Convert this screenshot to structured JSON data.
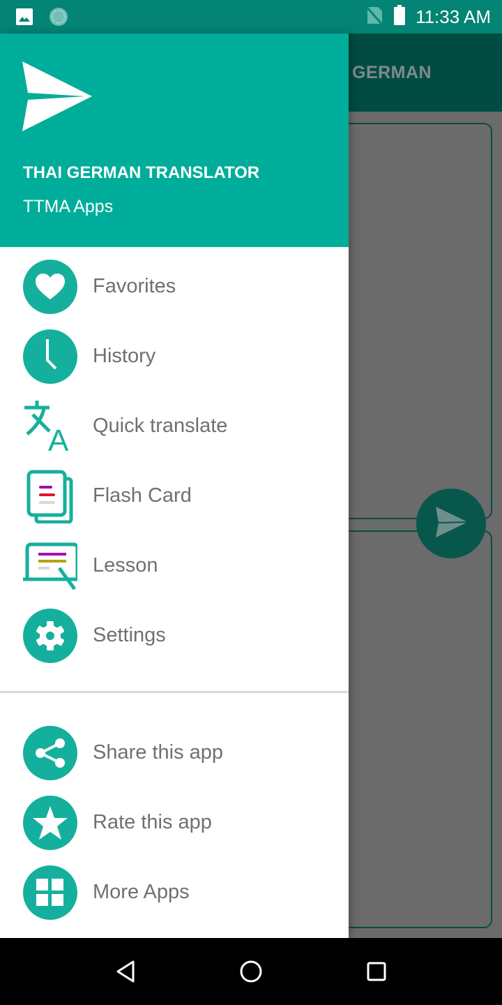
{
  "status_bar": {
    "time": "11:33 AM",
    "left_icons": [
      "gallery-icon",
      "sync-icon"
    ],
    "right_icons": [
      "no-sim-icon",
      "battery-icon"
    ]
  },
  "background_app": {
    "toolbar_title": "GERMAN",
    "fab_icon": "send-icon"
  },
  "drawer": {
    "header": {
      "logo_icon": "paper-plane-icon",
      "title": "THAI GERMAN TRANSLATOR",
      "subtitle": "TTMA Apps"
    },
    "primary_items": [
      {
        "label": "Favorites",
        "icon": "heart-icon"
      },
      {
        "label": "History",
        "icon": "clock-icon"
      },
      {
        "label": "Quick translate",
        "icon": "translate-icon"
      },
      {
        "label": "Flash Card",
        "icon": "flash-card-icon"
      },
      {
        "label": "Lesson",
        "icon": "lesson-board-icon"
      },
      {
        "label": "Settings",
        "icon": "gear-icon"
      }
    ],
    "secondary_items": [
      {
        "label": "Share this app",
        "icon": "share-icon"
      },
      {
        "label": "Rate this app",
        "icon": "star-icon"
      },
      {
        "label": "More Apps",
        "icon": "grid-icon"
      }
    ]
  },
  "nav_bar": {
    "buttons": [
      "back",
      "home",
      "recents"
    ]
  },
  "colors": {
    "accent": "#00ad9a",
    "status_bar": "#038474",
    "icon_circle": "#15b09d",
    "label_text": "#707070",
    "dim_toolbar": "#004c42"
  }
}
